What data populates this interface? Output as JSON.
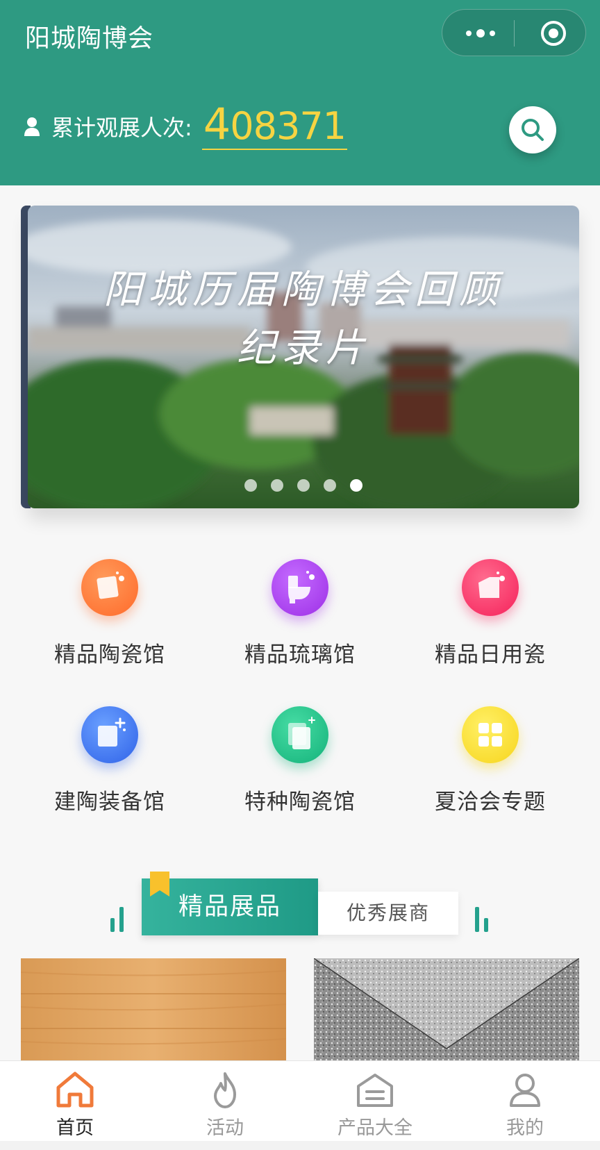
{
  "app": {
    "title": "阳城陶博会"
  },
  "visitors": {
    "label": "累计观展人次:",
    "count_first": "4",
    "count_rest": "08371"
  },
  "banner": {
    "title_line1": "阳城历届陶博会回顾",
    "title_line2": "纪录片",
    "slide_count": 5,
    "active_index": 4
  },
  "categories": [
    {
      "label": "精品陶瓷馆",
      "icon": "ceramic-hall-icon",
      "color": "#ff7a3c"
    },
    {
      "label": "精品琉璃馆",
      "icon": "toilet-icon",
      "color": "#b045f0"
    },
    {
      "label": "精品日用瓷",
      "icon": "daily-ceramic-icon",
      "color": "#ff3b6a"
    },
    {
      "label": "建陶装备馆",
      "icon": "equipment-icon",
      "color": "#3d7cf5"
    },
    {
      "label": "特种陶瓷馆",
      "icon": "special-ceramic-icon",
      "color": "#1fc389"
    },
    {
      "label": "夏洽会专题",
      "icon": "grid-apps-icon",
      "color": "#ffdc2e"
    }
  ],
  "tabs": {
    "active": "精品展品",
    "inactive": "优秀展商"
  },
  "bottom_nav": [
    {
      "label": "首页",
      "icon": "home-icon",
      "active": true
    },
    {
      "label": "活动",
      "icon": "flame-icon",
      "active": false
    },
    {
      "label": "产品大全",
      "icon": "product-box-icon",
      "active": false
    },
    {
      "label": "我的",
      "icon": "user-icon",
      "active": false
    }
  ],
  "colors": {
    "header": "#2e9a82",
    "accent_yellow": "#f6d442",
    "nav_active": "#f07a3a"
  }
}
